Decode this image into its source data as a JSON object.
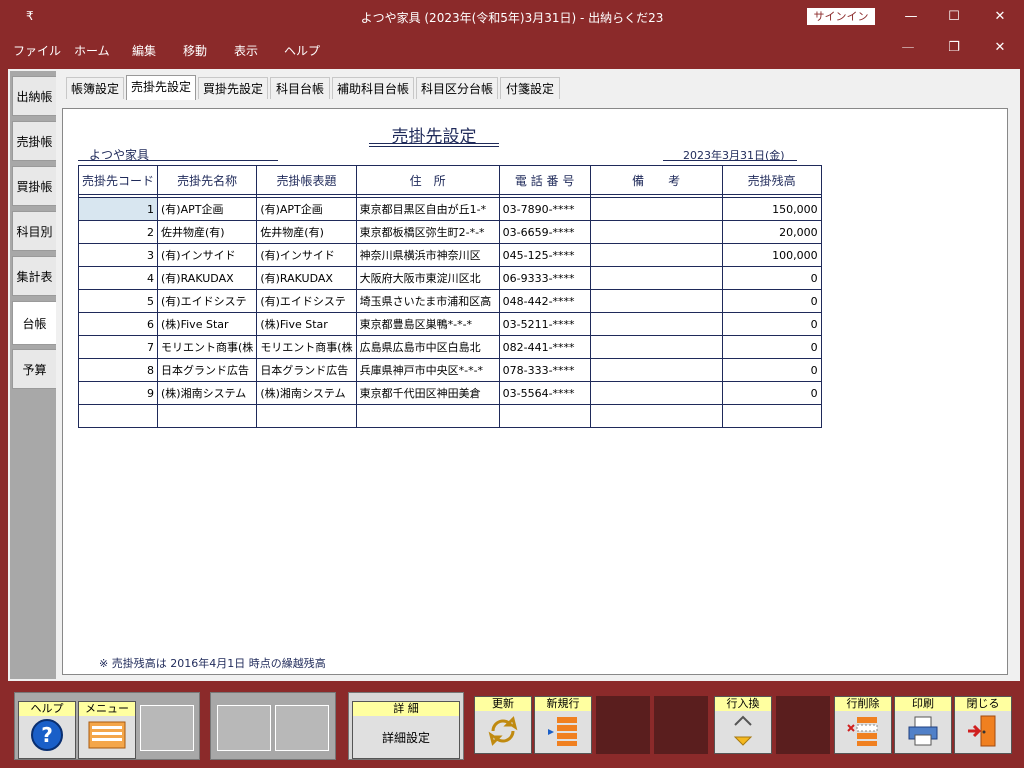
{
  "window": {
    "qa_glyph": "₹",
    "title": "よつや家具 (2023年(令和5年)3月31日)  -  出納らくだ23",
    "signin": "サインイン",
    "min": "—",
    "max": "☐",
    "close": "✕"
  },
  "menu": {
    "items": [
      "ファイル",
      "ホーム",
      "編集",
      "移動",
      "表示",
      "ヘルプ"
    ],
    "ctl_min": "—",
    "ctl_restore": "❐",
    "ctl_close": "✕"
  },
  "left_tabs": [
    "出納帳",
    "売掛帳",
    "買掛帳",
    "科目別",
    "集計表",
    "台帳",
    "予算"
  ],
  "top_tabs": [
    "帳簿設定",
    "売掛先設定",
    "買掛先設定",
    "科目台帳",
    "補助科目台帳",
    "科目区分台帳",
    "付箋設定"
  ],
  "panel": {
    "title": "売掛先設定",
    "company": "よつや家具",
    "date": "2023年3月31日(金)"
  },
  "table": {
    "headers": [
      "売掛先コード",
      "売掛先名称",
      "売掛帳表題",
      "住　所",
      "電 話 番 号",
      "備　　考",
      "売掛残高"
    ],
    "rows": [
      [
        "1",
        "(有)APT企画",
        "(有)APT企画",
        "東京都目黒区自由が丘1-*",
        "03-7890-****",
        "",
        "150,000"
      ],
      [
        "2",
        "佐井物産(有)",
        "佐井物産(有)",
        "東京都板橋区弥生町2-*-*",
        "03-6659-****",
        "",
        "20,000"
      ],
      [
        "3",
        "(有)インサイド",
        "(有)インサイド",
        "神奈川県横浜市神奈川区",
        "045-125-****",
        "",
        "100,000"
      ],
      [
        "4",
        "(有)RAKUDAX",
        "(有)RAKUDAX",
        "大阪府大阪市東淀川区北",
        "06-9333-****",
        "",
        "0"
      ],
      [
        "5",
        "(有)エイドシステ",
        "(有)エイドシステ",
        "埼玉県さいたま市浦和区高",
        "048-442-****",
        "",
        "0"
      ],
      [
        "6",
        "(株)Five Star",
        "(株)Five Star",
        "東京都豊島区巣鴨*-*-*",
        "03-5211-****",
        "",
        "0"
      ],
      [
        "7",
        "モリエント商事(株",
        "モリエント商事(株",
        "広島県広島市中区白島北",
        "082-441-****",
        "",
        "0"
      ],
      [
        "8",
        "日本グランド広告",
        "日本グランド広告",
        "兵庫県神戸市中央区*-*-*",
        "078-333-****",
        "",
        "0"
      ],
      [
        "9",
        "(株)湘南システム",
        "(株)湘南システム",
        "東京都千代田区神田美倉",
        "03-5564-****",
        "",
        "0"
      ],
      [
        "",
        "",
        "",
        "",
        "",
        "",
        ""
      ]
    ]
  },
  "note": "※ 売掛残高は 2016年4月1日 時点の繰越残高",
  "toolbar": {
    "help": "ヘルプ",
    "menu": "メニュー",
    "detail": "詳 細",
    "detail_sub": "詳細設定",
    "update": "更新",
    "new_row": "新規行",
    "row_swap": "行入換",
    "row_delete": "行削除",
    "print": "印刷",
    "close": "閉じる",
    "help_glyph": "?"
  }
}
